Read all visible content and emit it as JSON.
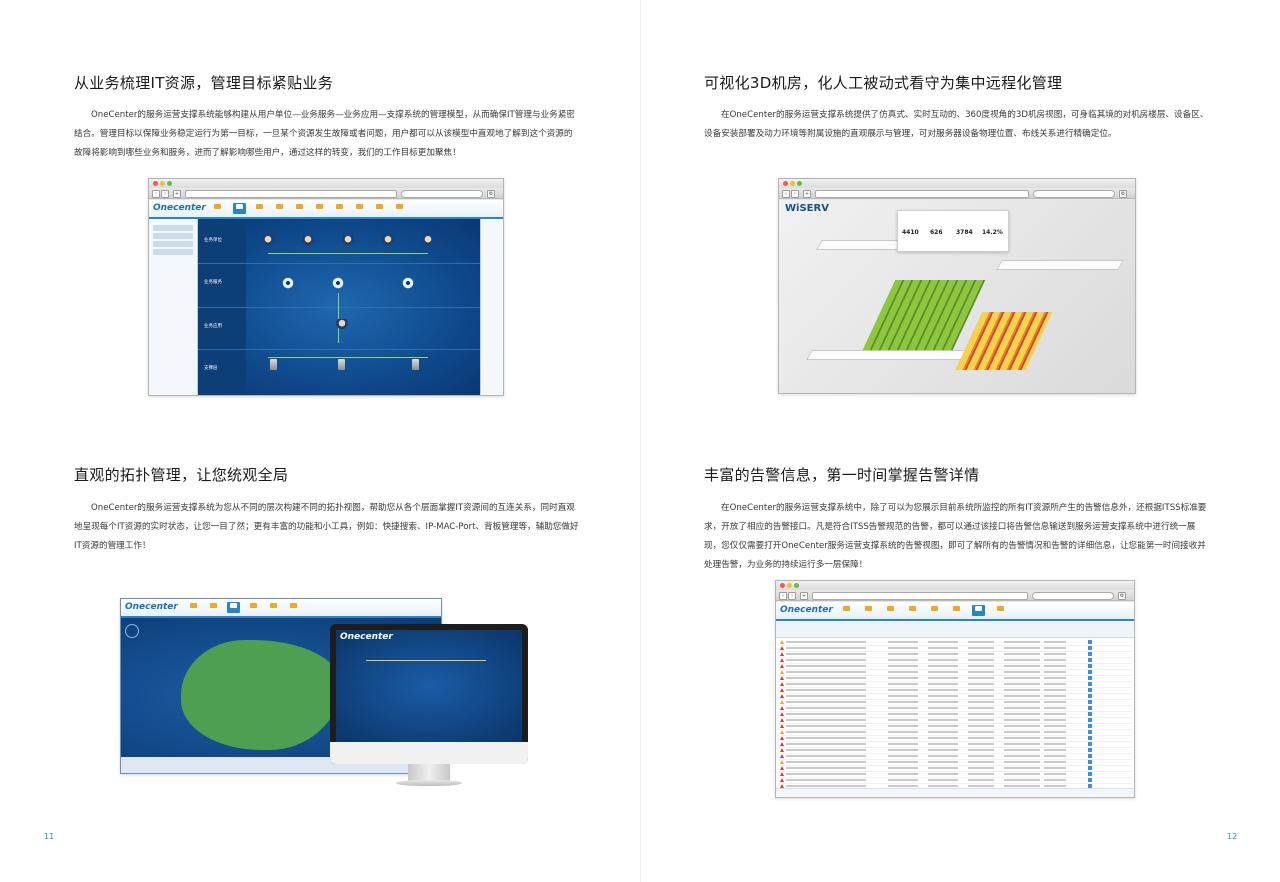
{
  "left_page": {
    "section1": {
      "title": "从业务梳理IT资源，管理目标紧贴业务",
      "body": "OneCenter的服务运营支撑系统能够构建从用户单位—业务服务—业务应用—支撑系统的管理模型，从而确保IT管理与业务紧密结合。管理目标以保障业务稳定运行为第一目标，一旦某个资源发生故障或者问题，用户都可以从该模型中直观地了解到这个资源的故障将影响到哪些业务和服务，进而了解影响哪些用户，通过这样的转变，我们的工作目标更加聚焦！",
      "screenshot": {
        "logo": "Onecenter",
        "lanes": [
          "业务单位",
          "业务服务",
          "业务应用",
          "支撑层"
        ]
      }
    },
    "section2": {
      "title": "直观的拓扑管理，让您统观全局",
      "body": "OneCenter的服务运营支撑系统为您从不同的层次构建不同的拓扑视图，帮助您从各个层面掌握IT资源间的互连关系，同时直观地呈现每个IT资源的实时状态，让您一目了然；更有丰富的功能和小工具，例如：快捷搜索、IP-MAC-Port、背板管理等，辅助您做好IT资源的管理工作！",
      "screenshot": {
        "logo": "Onecenter",
        "monitor_logo": "Onecenter"
      }
    },
    "page_number": "11"
  },
  "right_page": {
    "section1": {
      "title": "可视化3D机房，化人工被动式看守为集中远程化管理",
      "body": "在OneCenter的服务运营支撑系统提供了仿真式、实时互动的、360度视角的3D机房视图，可身临其境的对机房楼层、设备区、设备安装部署及动力环境等附属设施的直观展示与管理，可对服务器设备物理位置、布线关系进行精确定位。",
      "screenshot": {
        "logo": "WiSERV",
        "stats": [
          "4410",
          "626",
          "3784",
          "14.2%"
        ]
      }
    },
    "section2": {
      "title": "丰富的告警信息，第一时间掌握告警详情",
      "body": "在OneCenter的服务运营支撑系统中，除了可以为您展示目前系统所监控的所有IT资源所产生的告警信息外，还根据ITSS标准要求，开放了相应的告警接口。凡是符合ITSS告警规范的告警，都可以通过该接口将告警信息输送到服务运营支撑系统中进行统一展现，您仅仅需要打开OneCenter服务运营支撑系统的告警视图，即可了解所有的告警情况和告警的详细信息，让您能第一时间接收并处理告警，为业务的持续运行多一层保障！",
      "screenshot": {
        "logo": "Onecenter"
      }
    },
    "page_number": "12"
  },
  "colors": {
    "accent_blue": "#1f8fd6",
    "header_blue": "#2a84c9",
    "alert_red": "#d93b2f",
    "alert_yellow": "#f1a919",
    "rack_green": "#8dc63f"
  }
}
